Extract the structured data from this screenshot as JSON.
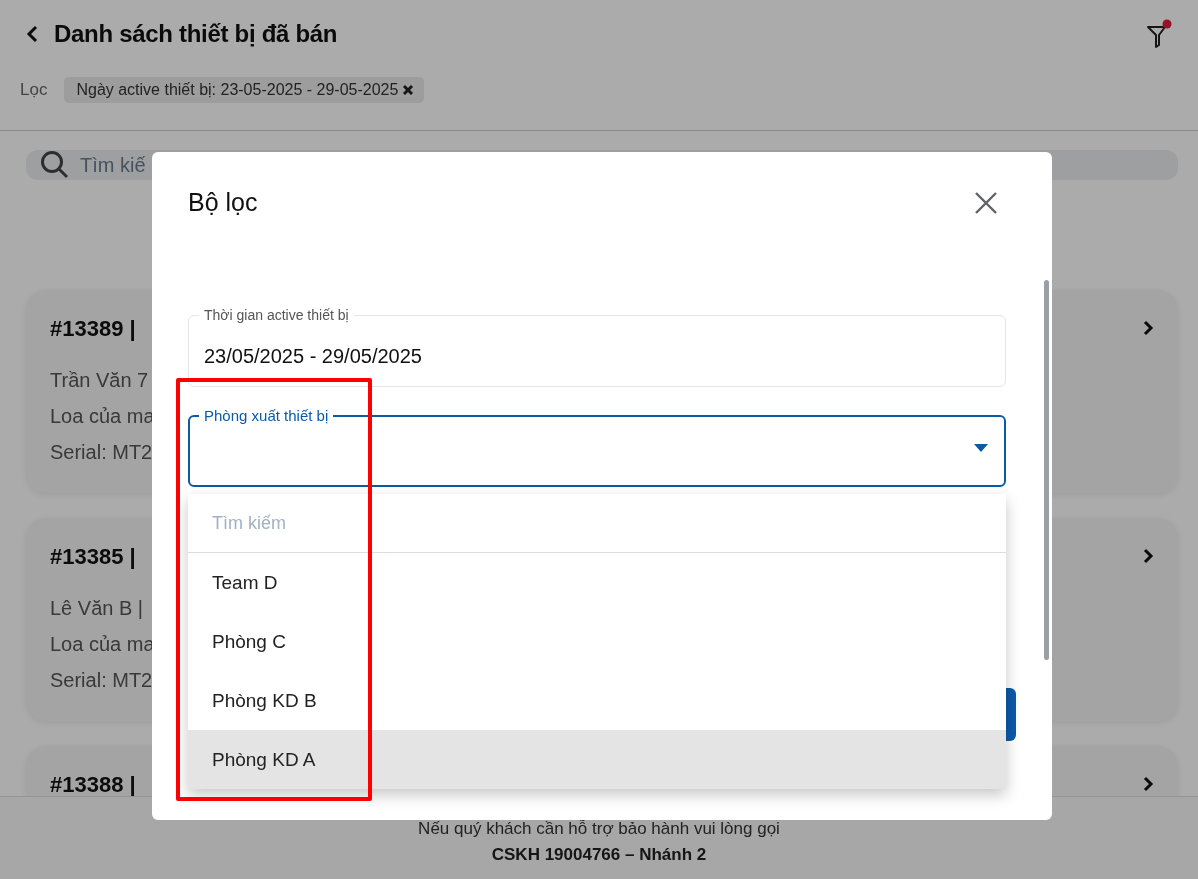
{
  "header": {
    "title": "Danh sách thiết bị đã bán",
    "filter_active": true
  },
  "filter_bar": {
    "label": "Lọc",
    "chips": [
      {
        "text": "Ngày active thiết bị: 23-05-2025 - 29-05-2025"
      }
    ]
  },
  "search": {
    "placeholder": "Tìm kiế"
  },
  "devices": [
    {
      "title": "#13389 |",
      "lines": [
        "Trần Văn 7",
        "Loa của ma",
        "Serial: MT2"
      ]
    },
    {
      "title": "#13385 |",
      "lines": [
        "Lê Văn B |",
        "Loa của ma",
        "Serial: MT2"
      ]
    },
    {
      "title": "#13388 |"
    }
  ],
  "footer": {
    "note": "Nếu quý khách cần hỗ trợ bảo hành vui lòng gọi",
    "hotline": "CSKH 19004766 – Nhánh 2"
  },
  "dialog": {
    "title": "Bộ lọc",
    "fields": [
      {
        "kind": "text",
        "label": "Thời gian active thiết bị",
        "value": "23/05/2025 - 29/05/2025",
        "focused": false
      },
      {
        "kind": "select",
        "label": "Phòng xuất thiết bị",
        "focused": true,
        "expanded": true
      }
    ],
    "dropdown": {
      "search_placeholder": "Tìm kiếm",
      "options": [
        {
          "label": "Team D",
          "selected": false
        },
        {
          "label": "Phòng C",
          "selected": false
        },
        {
          "label": "Phòng KD B",
          "selected": false
        },
        {
          "label": "Phòng KD A",
          "selected": true
        }
      ]
    }
  },
  "highlight": true
}
